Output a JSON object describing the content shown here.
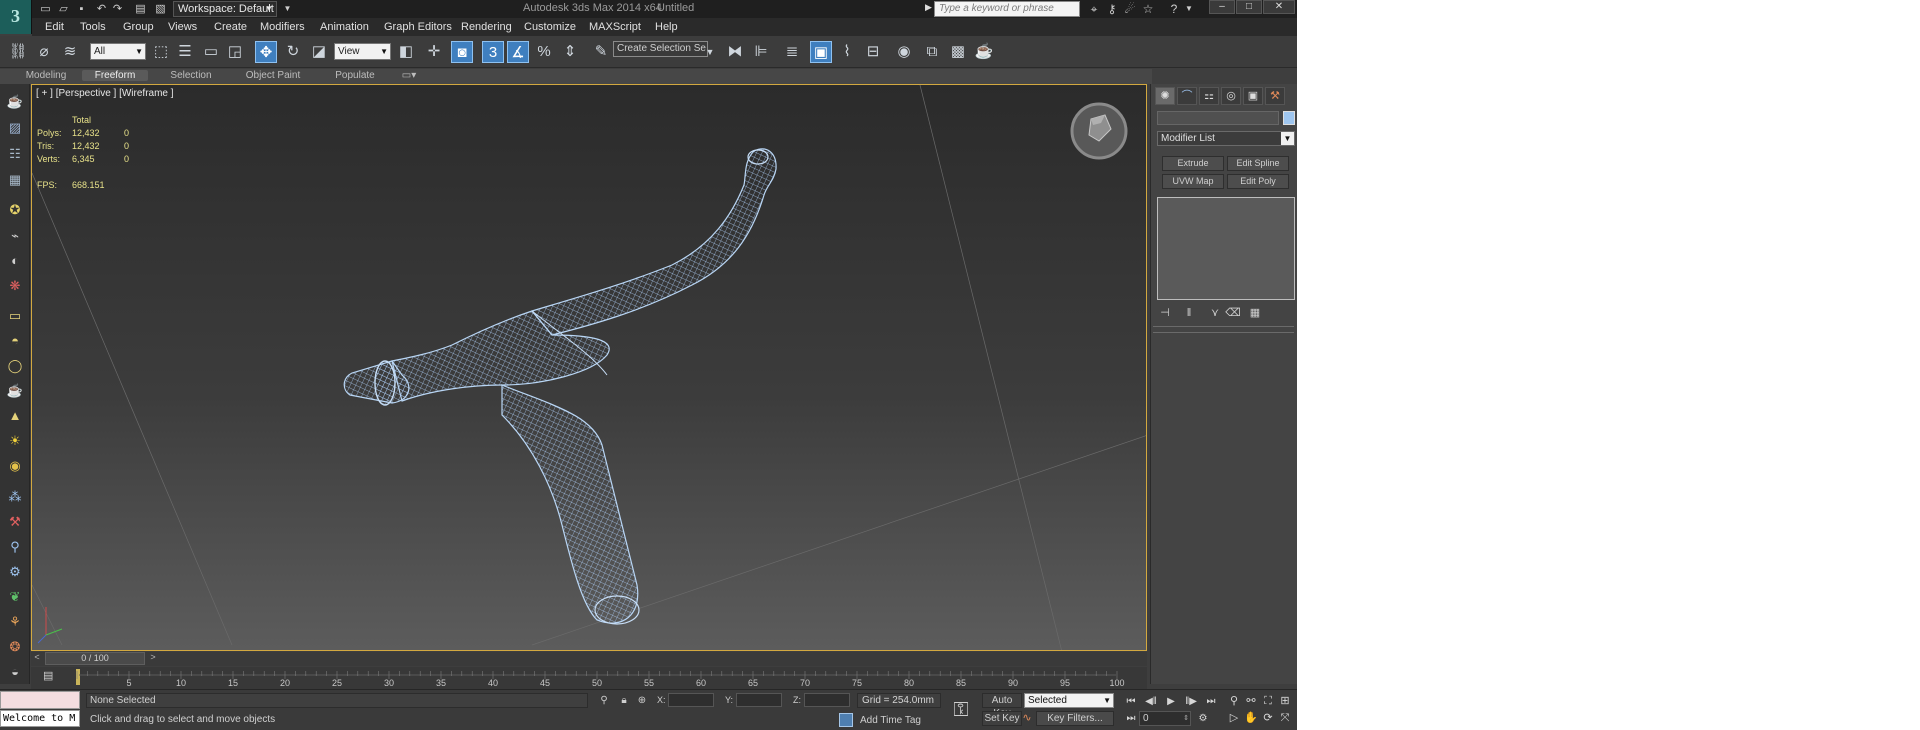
{
  "titlebar": {
    "workspace": "Workspace: Default",
    "app_title": "Autodesk 3ds Max  2014 x64",
    "document": "Untitled",
    "search_placeholder": "Type a keyword or phrase"
  },
  "menu": [
    "Edit",
    "Tools",
    "Group",
    "Views",
    "Create",
    "Modifiers",
    "Animation",
    "Graph Editors",
    "Rendering",
    "Customize",
    "MAXScript",
    "Help"
  ],
  "toolbar": {
    "selection_filter": "All",
    "ref_coord": "View",
    "named_selection": "Create Selection Se"
  },
  "ribbon_tabs": [
    "Modeling",
    "Freeform",
    "Selection",
    "Object Paint",
    "Populate"
  ],
  "ribbon_active": "Freeform",
  "viewport": {
    "label": "[ + ] [Perspective ] [Wireframe ]",
    "stats_header": "Total",
    "stats": [
      {
        "label": "Polys:",
        "total": "12,432",
        "sel": "0"
      },
      {
        "label": "Tris:",
        "total": "12,432",
        "sel": "0"
      },
      {
        "label": "Verts:",
        "total": "6,345",
        "sel": "0"
      }
    ],
    "fps_label": "FPS:",
    "fps_value": "668.151",
    "wire_color": "#a9c8ee"
  },
  "command_panel": {
    "modifier_list": "Modifier List",
    "buttons": [
      "Extrude",
      "Edit Spline",
      "UVW Map",
      "Edit Poly"
    ]
  },
  "timeline": {
    "position": "0 / 100",
    "ticks": [
      "5",
      "10",
      "15",
      "20",
      "25",
      "30",
      "35",
      "40",
      "45",
      "50",
      "55",
      "60",
      "65",
      "70",
      "75",
      "80",
      "85",
      "90",
      "95",
      "100"
    ]
  },
  "status": {
    "listener_text": "Welcome to M",
    "selection": "None Selected",
    "prompt": "Click and drag to select and move objects",
    "x_label": "X:",
    "y_label": "Y:",
    "z_label": "Z:",
    "grid": "Grid = 254.0mm",
    "add_time_tag": "Add Time Tag",
    "auto_key": "Auto Key",
    "set_key": "Set Key",
    "selected_option": "Selected",
    "key_filters": "Key Filters...",
    "frame": "0"
  },
  "colors": {
    "viewport_border": "#d3a940",
    "active_tool": "#3f7fbf",
    "stats_text": "#e8e28a"
  }
}
